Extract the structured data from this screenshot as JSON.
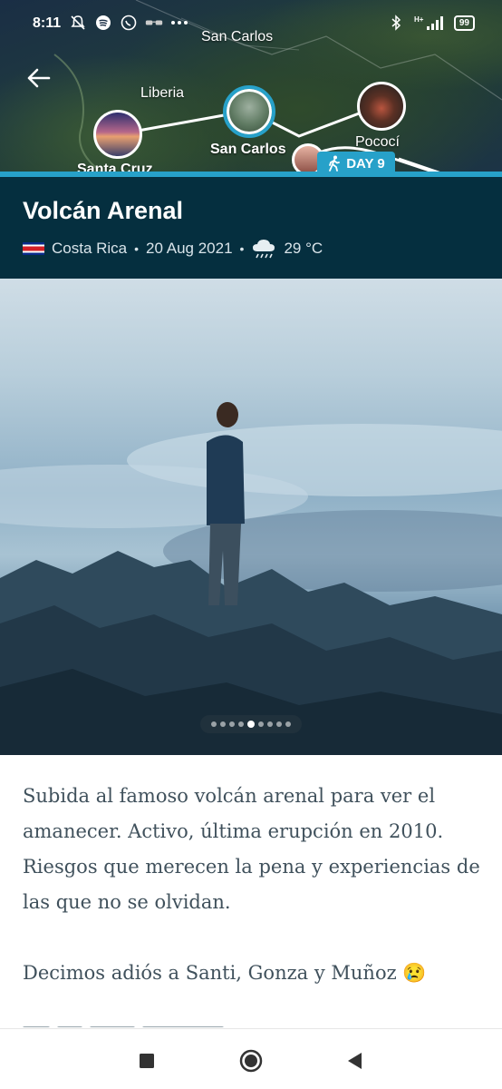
{
  "status_bar": {
    "time": "8:11",
    "battery": "99",
    "network": "H+",
    "icons_left": [
      "mute-icon",
      "spotify-icon",
      "whatsapp-icon",
      "glasses-icon",
      "more-icon"
    ],
    "icons_right": [
      "bluetooth-icon",
      "signal-icon",
      "battery-icon"
    ]
  },
  "map": {
    "labels": {
      "san_carlos_top": "San Carlos",
      "liberia": "Liberia",
      "san_carlos": "San Carlos",
      "pococi": "Pococí",
      "santa_cruz": "Santa Cruz"
    },
    "day_badge": "DAY 9",
    "accent_color": "#27a1c9"
  },
  "header": {
    "title": "Volcán Arenal",
    "country": "Costa Rica",
    "date": "20 Aug 2021",
    "weather_icon": "cloud-rain-icon",
    "temperature": "29 °C"
  },
  "photo": {
    "dot_count": 9,
    "active_dot": 5
  },
  "description": {
    "paragraph1": "Subida al famoso volcán arenal para ver el amanecer. Activo, última erupción en 2010. Riesgos que merecen la pena y experiencias de las que no se olvidan.",
    "paragraph2": "Decimos adiós a Santi, Gonza y Muñoz 😢"
  },
  "nav": {
    "icons": [
      "recents-icon",
      "home-icon",
      "back-icon"
    ]
  },
  "colors": {
    "title_band": "#052f3f",
    "accent": "#27a1c9",
    "body_text": "#40515c"
  }
}
